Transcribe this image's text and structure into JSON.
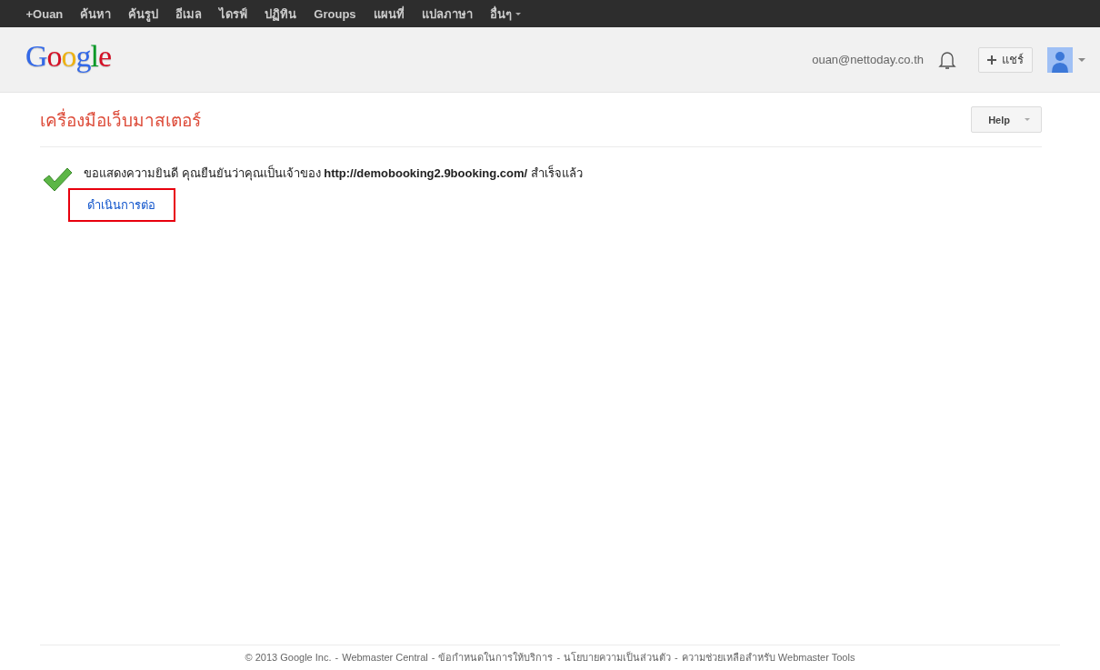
{
  "top_nav": [
    {
      "label": "+Ouan",
      "kind": "link"
    },
    {
      "label": "ค้นหา",
      "kind": "link"
    },
    {
      "label": "ค้นรูป",
      "kind": "link"
    },
    {
      "label": "อีเมล",
      "kind": "link"
    },
    {
      "label": "ไดรฟ์",
      "kind": "link"
    },
    {
      "label": "ปฏิทิน",
      "kind": "link"
    },
    {
      "label": "Groups",
      "kind": "link"
    },
    {
      "label": "แผนที่",
      "kind": "link"
    },
    {
      "label": "แปลภาษา",
      "kind": "link"
    },
    {
      "label": "อื่นๆ",
      "kind": "menu"
    }
  ],
  "header": {
    "logo": "Google",
    "email": "ouan@nettoday.co.th",
    "share_button": "แชร์"
  },
  "page_title": "เครื่องมือเว็บมาสเตอร์",
  "help_button": "Help",
  "message": {
    "text": "ขอแสดงความยินดี คุณยืนยันว่าคุณเป็นเจ้าของ **http://demobooking2.9booking.com/** สำเร็จแล้ว",
    "link": "ดำเนินการต่อ",
    "link_highlighted": true
  },
  "footer": {
    "copyright": "© 2013 Google Inc.",
    "links": [
      {
        "separator": "-",
        "text": "Webmaster Central"
      },
      {
        "separator": "-",
        "text": "ข้อกำหนดในการให้บริการ"
      },
      {
        "separator": "-",
        "text": "นโยบายความเป็นส่วนตัว"
      },
      {
        "separator": "-",
        "text": "ความช่วยเหลือสำหรับ Webmaster Tools"
      }
    ]
  }
}
